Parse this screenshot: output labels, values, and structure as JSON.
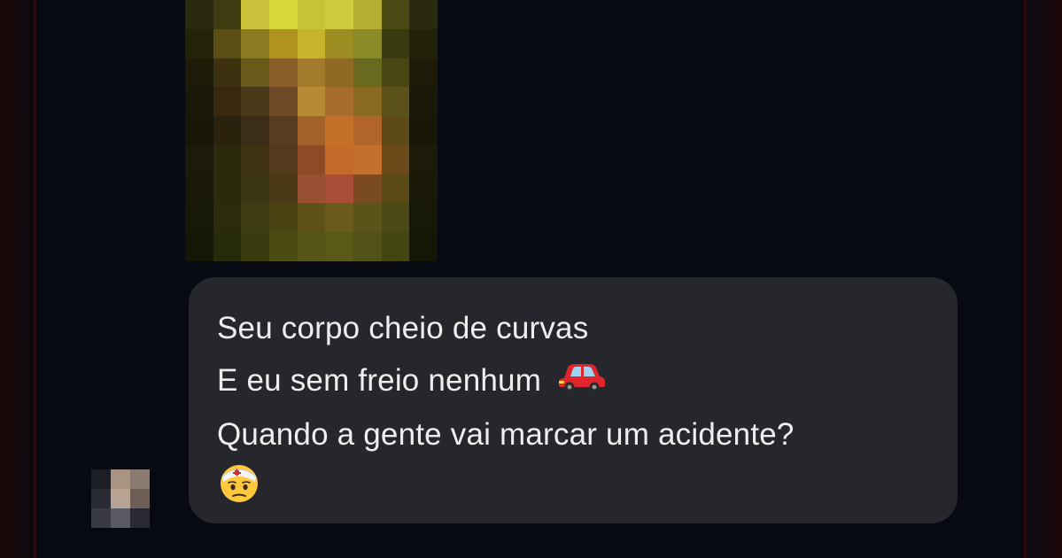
{
  "conversation": {
    "message": {
      "lines": [
        "Seu corpo cheio de curvas",
        "E eu sem freio nenhum",
        "Quando a gente vai marcar um acidente?"
      ],
      "emojis": [
        "red-car-emoji",
        "face-with-head-bandage-emoji"
      ]
    }
  },
  "colors": {
    "background": "#070a13",
    "bubble": "#26272d",
    "text": "#eeeeee"
  }
}
